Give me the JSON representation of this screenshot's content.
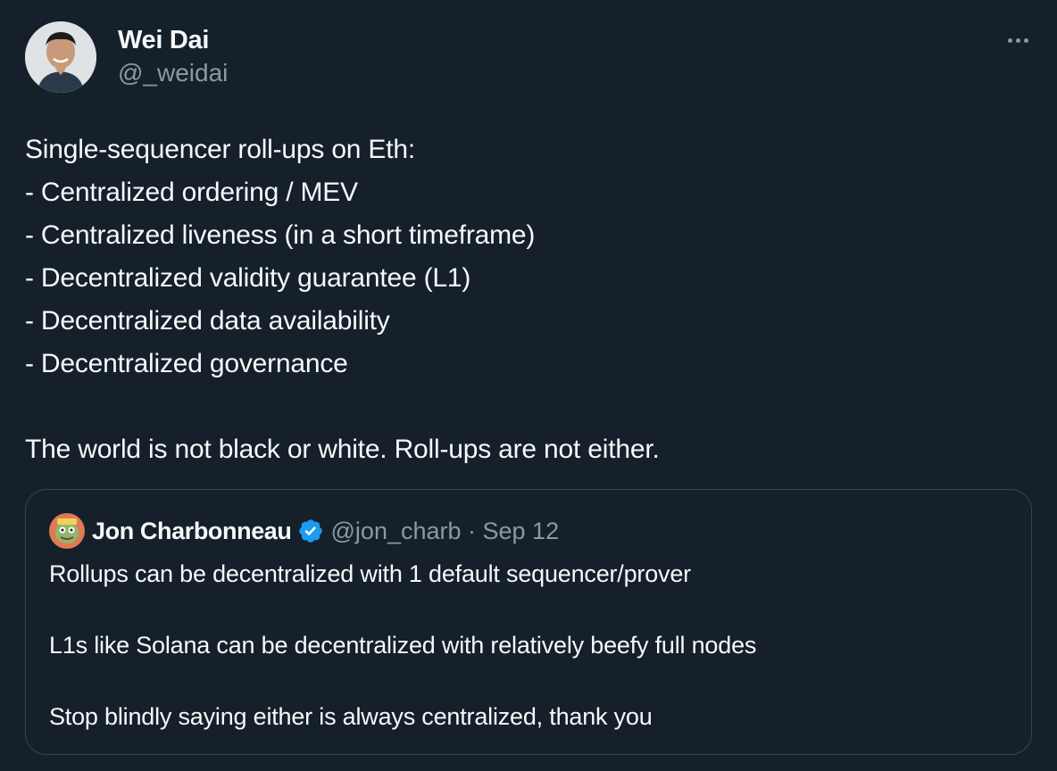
{
  "author": {
    "display_name": "Wei Dai",
    "handle": "@_weidai"
  },
  "menu": {
    "icon": "more-horizontal-icon"
  },
  "tweet": {
    "lines": [
      "Single-sequencer roll-ups on Eth:",
      "- Centralized ordering / MEV",
      "- Centralized liveness (in a short timeframe)",
      "- Decentralized validity guarantee (L1)",
      "- Decentralized data availability",
      "- Decentralized governance",
      "The world is not black or white. Roll-ups are not either."
    ]
  },
  "quoted_tweet": {
    "display_name": "Jon Charbonneau",
    "verified_icon": "verified-badge-icon",
    "meta": "@jon_charb · Sep 12",
    "lines": [
      "Rollups can be decentralized with 1 default sequencer/prover",
      "L1s like Solana can be decentralized with relatively beefy full nodes",
      "Stop blindly saying either is always centralized, thank you"
    ]
  },
  "colors": {
    "background": "#15202b",
    "text_primary": "#f7f9f9",
    "text_secondary": "#8b98a5",
    "border": "#38444d",
    "verified_blue": "#1d9bf0"
  }
}
